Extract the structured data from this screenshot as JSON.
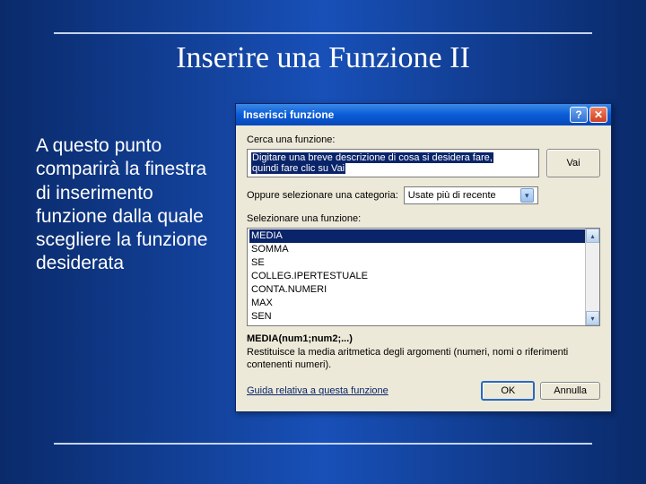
{
  "slide": {
    "title": "Inserire una Funzione II",
    "body": "A questo punto comparirà la finestra di inserimento funzione dalla quale scegliere la funzione desiderata"
  },
  "dialog": {
    "title": "Inserisci funzione",
    "search_label": "Cerca una funzione:",
    "search_text_line1": "Digitare una breve descrizione di cosa si desidera fare,",
    "search_text_line2": "quindi fare clic su Vai",
    "go_btn": "Vai",
    "category_label": "Oppure selezionare una categoria:",
    "category_value": "Usate più di recente",
    "select_label": "Selezionare una funzione:",
    "functions": [
      "MEDIA",
      "SOMMA",
      "SE",
      "COLLEG.IPERTESTUALE",
      "CONTA.NUMERI",
      "MAX",
      "SEN"
    ],
    "signature": "MEDIA(num1;num2;...)",
    "description": "Restituisce la media aritmetica degli argomenti (numeri, nomi o riferimenti contenenti numeri).",
    "help_link": "Guida relativa a questa funzione",
    "ok_btn": "OK",
    "cancel_btn": "Annulla"
  }
}
